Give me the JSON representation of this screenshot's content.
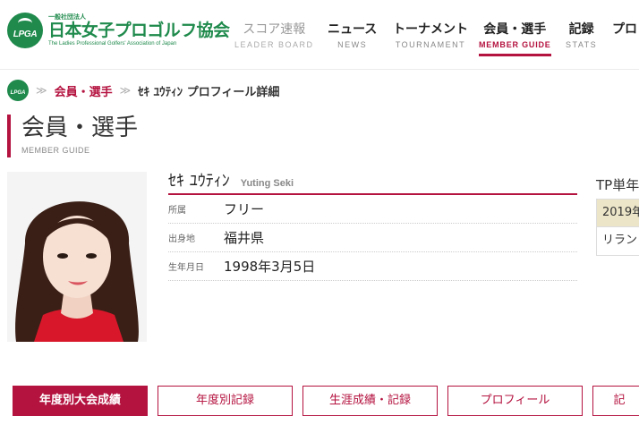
{
  "colors": {
    "brand_green": "#1f8a4c",
    "accent": "#b4123f",
    "tp_highlight": "#ece5c8"
  },
  "logo": {
    "emblem_text": "LPGA",
    "small": "一般社団法人",
    "main": "日本女子プロゴルフ協会",
    "en": "The Ladies Professional Golfers' Association of Japan"
  },
  "nav": [
    {
      "ja": "スコア速報",
      "en": "LEADER BOARD"
    },
    {
      "ja": "ニュース",
      "en": "NEWS"
    },
    {
      "ja": "トーナメント",
      "en": "TOURNAMENT"
    },
    {
      "ja": "会員・選手",
      "en": "MEMBER GUIDE",
      "active": true
    },
    {
      "ja": "記録",
      "en": "STATS"
    },
    {
      "ja": "プロ",
      "en": ""
    }
  ],
  "breadcrumb": {
    "home_icon": "lpga-logo-icon",
    "separator": "≫",
    "link": "会員・選手",
    "current": "ｾｷ ﾕｳﾃｨﾝ プロフィール詳細"
  },
  "page": {
    "title": "会員・選手",
    "subtitle": "MEMBER GUIDE"
  },
  "profile": {
    "name_ja": "ｾｷ ﾕｳﾃｨﾝ",
    "name_en": "Yuting Seki",
    "fields": [
      {
        "label": "所属",
        "value": "フリー"
      },
      {
        "label": "出身地",
        "value": "福井県"
      },
      {
        "label": "生年月日",
        "value": "1998年3月5日"
      }
    ]
  },
  "tp_panel": {
    "title": "TP単年",
    "row1": "2019年",
    "row2": "リラン"
  },
  "tabs": [
    {
      "label": "年度別大会成績",
      "active": true
    },
    {
      "label": "年度別記録"
    },
    {
      "label": "生涯成績・記録"
    },
    {
      "label": "プロフィール"
    },
    {
      "label": "記"
    }
  ]
}
